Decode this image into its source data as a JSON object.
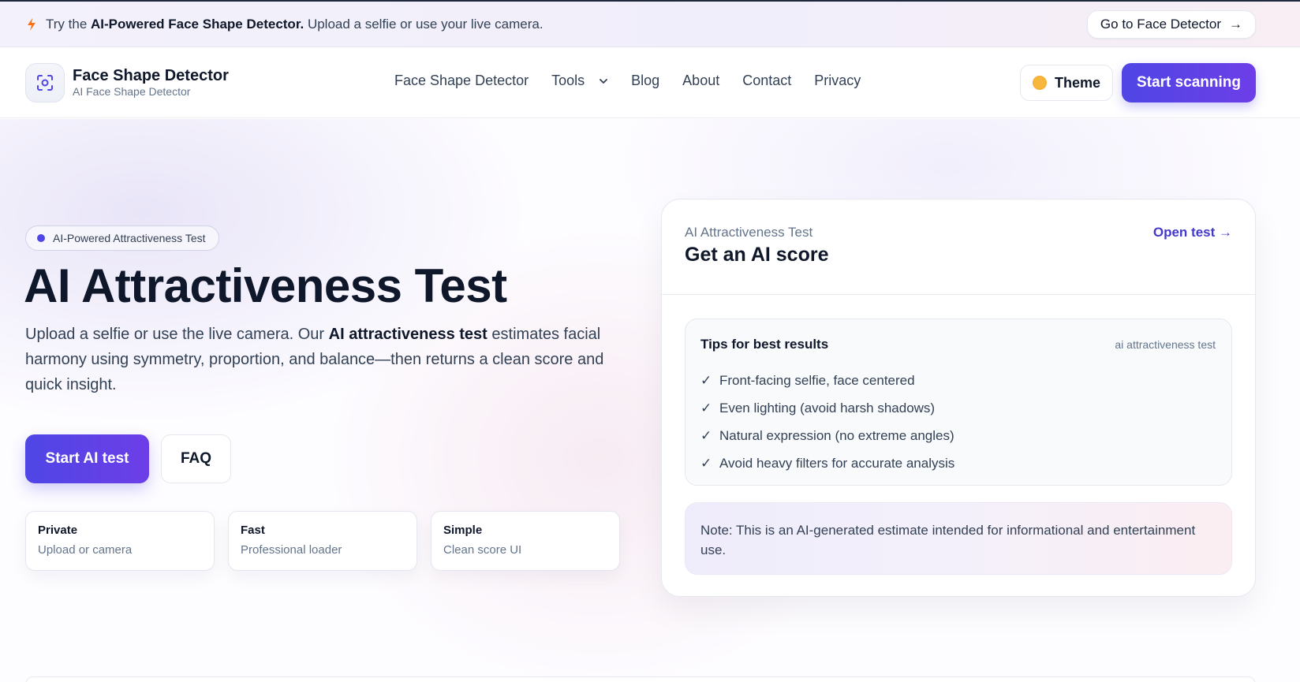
{
  "announcement": {
    "prefix": "Try the",
    "highlight": "AI-Powered Face Shape Detector.",
    "suffix": "Upload a selfie or use your live camera.",
    "cta_label": "Go to Face Detector",
    "cta_arrow": "→",
    "icon": "bolt-icon"
  },
  "header": {
    "brand_name": "Face Shape Detector",
    "brand_sub": "AI Face Shape Detector",
    "logo_icon": "face-scan-icon",
    "nav": [
      {
        "label": "Face Shape Detector"
      },
      {
        "label": "Tools"
      },
      {
        "label": "Blog"
      },
      {
        "label": "About"
      },
      {
        "label": "Contact"
      },
      {
        "label": "Privacy"
      }
    ],
    "theme_label": "Theme",
    "scan_label": "Start scanning"
  },
  "hero": {
    "pill": "AI-Powered Attractiveness Test",
    "title": "AI Attractiveness Test",
    "desc_before": "Upload a selfie or use the live camera. Our",
    "desc_bold": "AI attractiveness test",
    "desc_after": "estimates facial harmony using symmetry, proportion, and balance—then returns a clean score and quick insight.",
    "start_label": "Start AI test",
    "faq_label": "FAQ",
    "features": [
      {
        "title": "Private",
        "sub": "Upload or camera"
      },
      {
        "title": "Fast",
        "sub": "Professional loader"
      },
      {
        "title": "Simple",
        "sub": "Clean score UI"
      }
    ]
  },
  "card": {
    "kicker": "AI Attractiveness Test",
    "title": "Get an AI score",
    "open_label": "Open test →",
    "tips_title": "Tips for best results",
    "tips_tag": "ai attractiveness test",
    "check": "✓",
    "tips": [
      "Front-facing selfie, face centered",
      "Even lighting (avoid harsh shadows)",
      "Natural expression (no extreme angles)",
      "Avoid heavy filters for accurate analysis"
    ],
    "note": "Note: This is an AI-generated estimate intended for informational and entertainment use."
  },
  "colors": {
    "accent": "#4f46e5",
    "accent_2": "#6d3ee8",
    "text": "#0f172a",
    "muted": "#64748b"
  }
}
